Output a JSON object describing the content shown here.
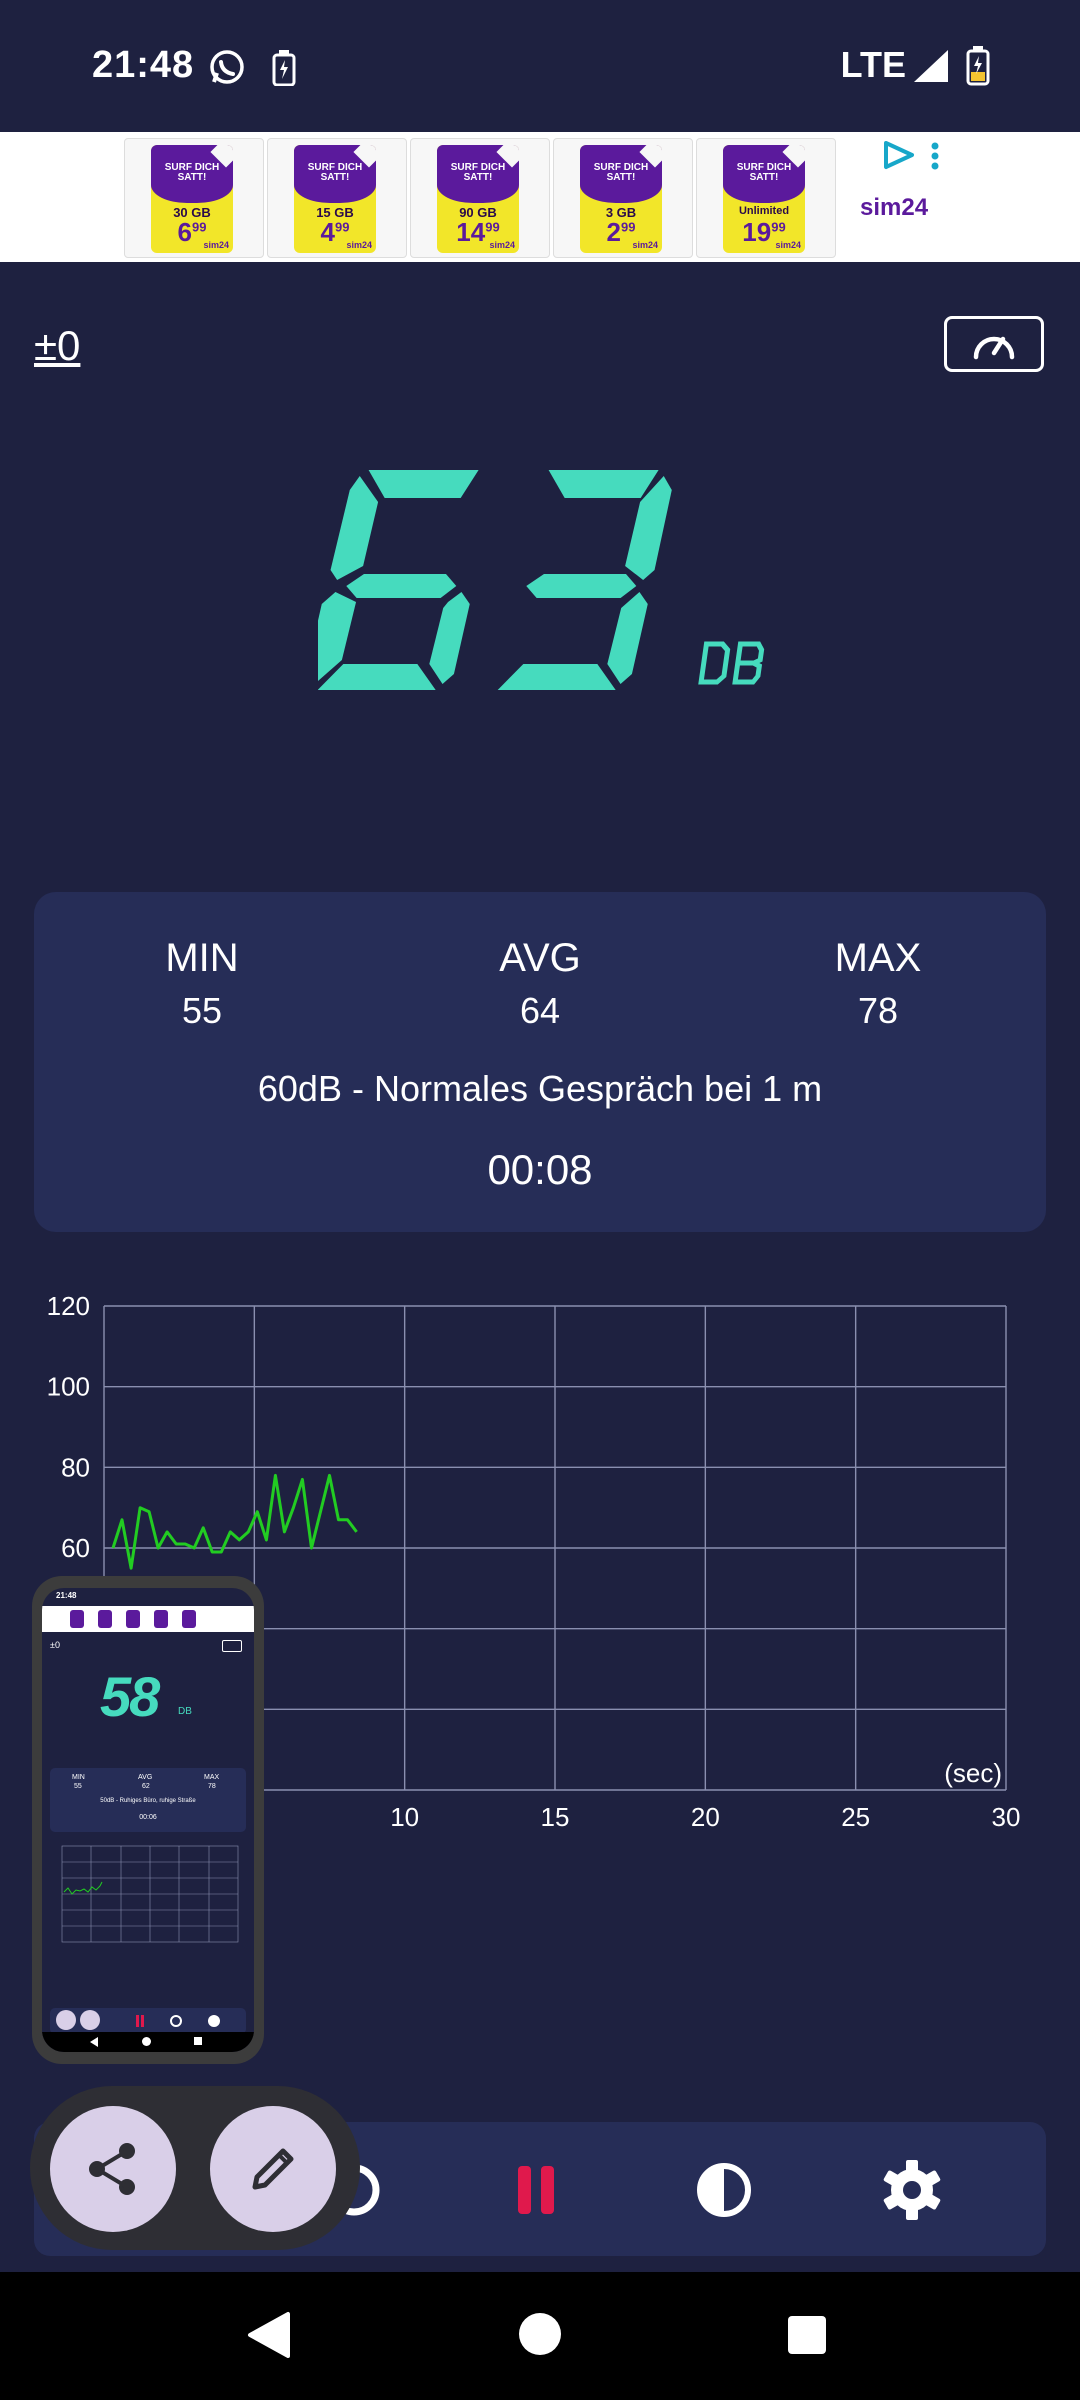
{
  "status_bar": {
    "time": "21:48",
    "network": "LTE",
    "icons": [
      "whatsapp-icon",
      "battery-charging-icon",
      "signal-icon",
      "battery-icon"
    ]
  },
  "ad": {
    "brand": "sim24",
    "cards": [
      {
        "headline": "SURF DICH SATT!",
        "data": "30 GB",
        "price": "6",
        "cents": "99"
      },
      {
        "headline": "SURF DICH SATT!",
        "data": "15 GB",
        "price": "4",
        "cents": "99"
      },
      {
        "headline": "SURF DICH SATT!",
        "data": "90 GB",
        "price": "14",
        "cents": "99"
      },
      {
        "headline": "SURF DICH SATT!",
        "data": "3 GB",
        "price": "2",
        "cents": "99"
      },
      {
        "headline": "SURF DICH SATT!",
        "data": "Unlimited",
        "price": "19",
        "cents": "99"
      }
    ],
    "card_brand": "sim24"
  },
  "meter": {
    "calibration": "±0",
    "reading": "63",
    "unit": "DB"
  },
  "stats": {
    "min_label": "MIN",
    "min_value": "55",
    "avg_label": "AVG",
    "avg_value": "64",
    "max_label": "MAX",
    "max_value": "78",
    "description": "60dB - Normales Gespräch bei 1 m",
    "elapsed": "00:08"
  },
  "chart_data": {
    "type": "line",
    "x_unit_label": "(sec)",
    "xlim": [
      0,
      30
    ],
    "ylim": [
      0,
      120
    ],
    "x_ticks": [
      10,
      15,
      20,
      25,
      30
    ],
    "y_ticks": [
      60,
      80,
      100,
      120
    ],
    "grid": true,
    "line_color": "#22cc22",
    "x": [
      0.3,
      0.6,
      0.9,
      1.2,
      1.5,
      1.8,
      2.1,
      2.4,
      2.7,
      3.0,
      3.3,
      3.6,
      3.9,
      4.2,
      4.5,
      4.8,
      5.1,
      5.4,
      5.7,
      6.0,
      6.3,
      6.6,
      6.9,
      7.2,
      7.5,
      7.8,
      8.1,
      8.4
    ],
    "y": [
      60,
      67,
      55,
      70,
      69,
      60,
      64,
      61,
      61,
      60,
      65,
      59,
      59,
      64,
      62,
      64,
      69,
      62,
      78,
      64,
      70,
      77,
      60,
      69,
      78,
      67,
      67,
      64
    ]
  },
  "thumbnail": {
    "time": "21:48",
    "reading": "58",
    "unit": "DB",
    "calibration": "±0",
    "min_label": "MIN",
    "min_value": "55",
    "avg_label": "AVG",
    "avg_value": "62",
    "max_label": "MAX",
    "max_value": "78",
    "description": "50dB - Ruhiges Büro, ruhige Straße",
    "elapsed": "00:06"
  },
  "toolbar": {
    "buttons": [
      "reset-icon",
      "pause-icon",
      "theme-contrast-icon",
      "settings-icon"
    ],
    "pause_color": "#e0194c"
  },
  "screenshot_actions": [
    "share-icon",
    "edit-pencil-icon"
  ],
  "nav": [
    "back-icon",
    "home-icon",
    "recents-icon"
  ],
  "colors": {
    "background": "#1e2140",
    "card": "#262d57",
    "accent": "#46dbbe"
  }
}
